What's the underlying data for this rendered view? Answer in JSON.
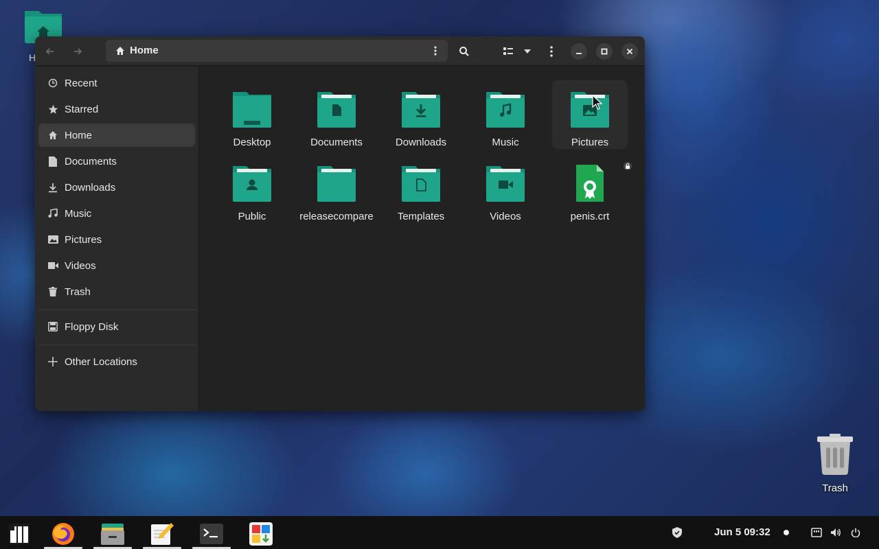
{
  "desktop": {
    "home_icon_label": "H",
    "trash_label": "Trash"
  },
  "window": {
    "path_title": "Home",
    "sidebar": {
      "items": [
        {
          "label": "Recent",
          "icon": "clock-icon"
        },
        {
          "label": "Starred",
          "icon": "star-icon"
        },
        {
          "label": "Home",
          "icon": "home-icon",
          "active": true
        },
        {
          "label": "Documents",
          "icon": "document-icon"
        },
        {
          "label": "Downloads",
          "icon": "download-icon"
        },
        {
          "label": "Music",
          "icon": "music-icon"
        },
        {
          "label": "Pictures",
          "icon": "image-icon"
        },
        {
          "label": "Videos",
          "icon": "video-icon"
        },
        {
          "label": "Trash",
          "icon": "trash-icon"
        }
      ],
      "devices": [
        {
          "label": "Floppy Disk",
          "icon": "floppy-icon"
        }
      ],
      "other": {
        "label": "Other Locations",
        "icon": "plus-icon"
      }
    },
    "files": [
      {
        "name": "Desktop",
        "icon": "folder-desktop-icon"
      },
      {
        "name": "Documents",
        "icon": "folder-documents-icon"
      },
      {
        "name": "Downloads",
        "icon": "folder-downloads-icon"
      },
      {
        "name": "Music",
        "icon": "folder-music-icon"
      },
      {
        "name": "Pictures",
        "icon": "folder-pictures-icon"
      },
      {
        "name": "Public",
        "icon": "folder-public-icon"
      },
      {
        "name": "releasecompare",
        "icon": "folder-icon"
      },
      {
        "name": "Templates",
        "icon": "folder-templates-icon"
      },
      {
        "name": "Videos",
        "icon": "folder-videos-icon"
      },
      {
        "name": "penis.crt",
        "icon": "certificate-file-icon",
        "locked": true
      }
    ]
  },
  "taskbar": {
    "apps": [
      "menu-icon",
      "firefox-icon",
      "files-icon",
      "text-editor-icon",
      "terminal-icon",
      "software-center-icon"
    ],
    "clock": "Jun 5  09:32"
  },
  "colors": {
    "folder": "#1fa68a",
    "folder_dark": "#158a72",
    "window_bg": "#222222",
    "sidebar_bg": "#2a2a2a"
  }
}
